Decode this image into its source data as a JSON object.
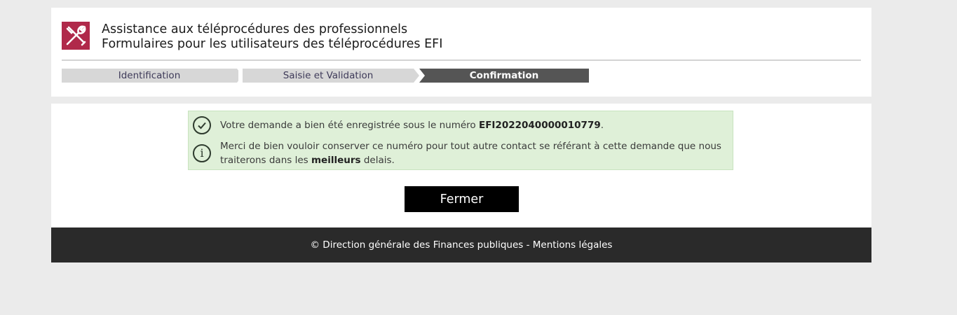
{
  "header": {
    "title_line1": "Assistance aux téléprocédures des professionnels",
    "title_line2": "Formulaires pour les utilisateurs des téléprocédures EFI",
    "logo_icon": "tools-icon",
    "logo_color": "#b0294a"
  },
  "steps": [
    {
      "label": "Identification",
      "state": "done"
    },
    {
      "label": "Saisie et Validation",
      "state": "done"
    },
    {
      "label": "Confirmation",
      "state": "active"
    }
  ],
  "alert": {
    "line1_prefix": "Votre demande a bien été enregistrée sous le numéro ",
    "request_number": "EFI2022040000010779",
    "line1_suffix": ".",
    "line2_part1": "Merci de bien vouloir conserver ce numéro pour tout autre contact se référant à cette demande que nous",
    "line2_part2_prefix": "traiterons dans les ",
    "line2_bold": "meilleurs",
    "line2_part2_suffix": " delais.",
    "check_icon": "check-circle-icon",
    "info_icon": "info-circle-icon"
  },
  "actions": {
    "close_label": "Fermer"
  },
  "footer": {
    "text": "© Direction générale des Finances publiques - Mentions légales"
  }
}
